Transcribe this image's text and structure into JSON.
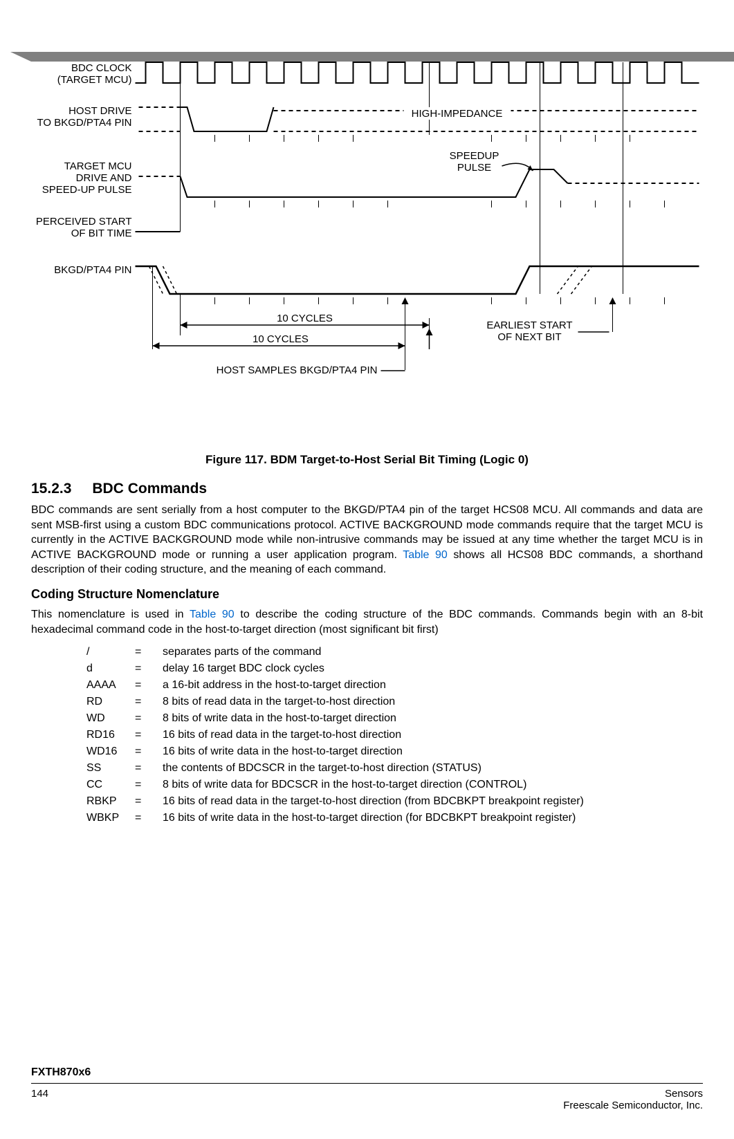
{
  "figure": {
    "labels": {
      "bdc_clock_l1": "BDC CLOCK",
      "bdc_clock_l2": "(TARGET MCU)",
      "host_drive_l1": "HOST DRIVE",
      "host_drive_l2": "TO BKGD/PTA4 PIN",
      "high_impedance": "HIGH-IMPEDANCE",
      "target_mcu_l1": "TARGET MCU",
      "target_mcu_l2": "DRIVE AND",
      "target_mcu_l3": "SPEED-UP PULSE",
      "speedup_l1": "SPEEDUP",
      "speedup_l2": "PULSE",
      "perceived_l1": "PERCEIVED START",
      "perceived_l2": "OF BIT TIME",
      "bkgd_pin": "BKGD/PTA4 PIN",
      "ten_cycles": "10 CYCLES",
      "earliest_l1": "EARLIEST START",
      "earliest_l2": "OF NEXT BIT",
      "host_samples": "HOST SAMPLES BKGD/PTA4 PIN"
    },
    "caption": "Figure 117. BDM Target-to-Host Serial Bit Timing (Logic 0)"
  },
  "section": {
    "number": "15.2.3",
    "title": "BDC Commands",
    "p1_a": "BDC commands are sent serially from a host computer to the BKGD/PTA4 pin of the target HCS08 MCU. All commands and data are sent MSB-first using a custom BDC communications protocol. ACTIVE BACKGROUND mode commands require that the target MCU is currently in the ACTIVE BACKGROUND mode while non-intrusive commands may be issued at any time whether the target MCU is in ACTIVE BACKGROUND mode or running a user application program. ",
    "p1_link": "Table 90",
    "p1_b": " shows all HCS08 BDC commands, a shorthand description of their coding structure, and the meaning of each command.",
    "subhead": "Coding Structure Nomenclature",
    "p2_a": "This nomenclature is used in ",
    "p2_link": "Table 90",
    "p2_b": " to describe the coding structure of the BDC commands. Commands begin with an 8-bit hexadecimal command code in the host-to-target direction (most significant bit first)",
    "nomenclature": [
      {
        "sym": "/",
        "desc": "separates parts of the command"
      },
      {
        "sym": "d",
        "desc": "delay 16 target BDC clock cycles"
      },
      {
        "sym": "AAAA",
        "desc": "a 16-bit address in the host-to-target direction"
      },
      {
        "sym": "RD",
        "desc": "8 bits of read data in the target-to-host direction"
      },
      {
        "sym": "WD",
        "desc": "8 bits of write data in the host-to-target direction"
      },
      {
        "sym": "RD16",
        "desc": "16 bits of read data in the target-to-host direction"
      },
      {
        "sym": "WD16",
        "desc": "16 bits of write data in the host-to-target direction"
      },
      {
        "sym": "SS",
        "desc": "the contents of BDCSCR in the target-to-host direction (STATUS)"
      },
      {
        "sym": "CC",
        "desc": "8 bits of write data for BDCSCR in the host-to-target direction (CONTROL)"
      },
      {
        "sym": "RBKP",
        "desc": "16 bits of read data in the target-to-host direction (from BDCBKPT breakpoint register)"
      },
      {
        "sym": "WBKP",
        "desc": "16 bits of write data in the host-to-target direction (for BDCBKPT breakpoint register)"
      }
    ]
  },
  "footer": {
    "device": "FXTH870x6",
    "page": "144",
    "right_l1": "Sensors",
    "right_l2": "Freescale Semiconductor, Inc."
  },
  "chart_data": {
    "type": "timing_diagram",
    "title": "BDM Target-to-Host Serial Bit Timing (Logic 0)",
    "clock_cycles_total": 16,
    "signals": [
      {
        "name": "BDC CLOCK (TARGET MCU)",
        "type": "square_wave",
        "period_cycles": 1
      },
      {
        "name": "HOST DRIVE TO BKGD/PTA4 PIN",
        "events": [
          {
            "at_cycle": 0,
            "level": "high"
          },
          {
            "at_cycle": 1,
            "level": "low"
          },
          {
            "at_cycle": 4,
            "level": "high-impedance"
          }
        ]
      },
      {
        "name": "TARGET MCU DRIVE AND SPEED-UP PULSE",
        "events": [
          {
            "at_cycle": 0,
            "level": "high-impedance"
          },
          {
            "at_cycle": 1,
            "level": "low"
          },
          {
            "at_cycle": 11,
            "level": "high",
            "note": "SPEEDUP PULSE"
          },
          {
            "at_cycle": 12,
            "level": "high-impedance"
          }
        ]
      },
      {
        "name": "BKGD/PTA4 PIN",
        "events": [
          {
            "at_cycle": 0,
            "level": "high"
          },
          {
            "at_cycle": 1,
            "level": "low"
          },
          {
            "at_cycle": 11,
            "level": "high"
          }
        ]
      }
    ],
    "annotations": [
      {
        "text": "PERCEIVED START OF BIT TIME",
        "at_cycle": 1
      },
      {
        "text": "10 CYCLES",
        "from_cycle": 1,
        "to_cycle": 11,
        "row": "dimension"
      },
      {
        "text": "10 CYCLES",
        "from_cycle": 0,
        "to_cycle": 10,
        "row": "dimension2"
      },
      {
        "text": "HOST SAMPLES BKGD/PTA4 PIN",
        "at_cycle": 10
      },
      {
        "text": "EARLIEST START OF NEXT BIT",
        "at_cycle": 15
      },
      {
        "text": "HIGH-IMPEDANCE",
        "at_cycle": 8,
        "signal": "HOST DRIVE TO BKGD/PTA4 PIN"
      },
      {
        "text": "SPEEDUP PULSE",
        "at_cycle": 11,
        "signal": "TARGET MCU DRIVE AND SPEED-UP PULSE"
      }
    ]
  }
}
